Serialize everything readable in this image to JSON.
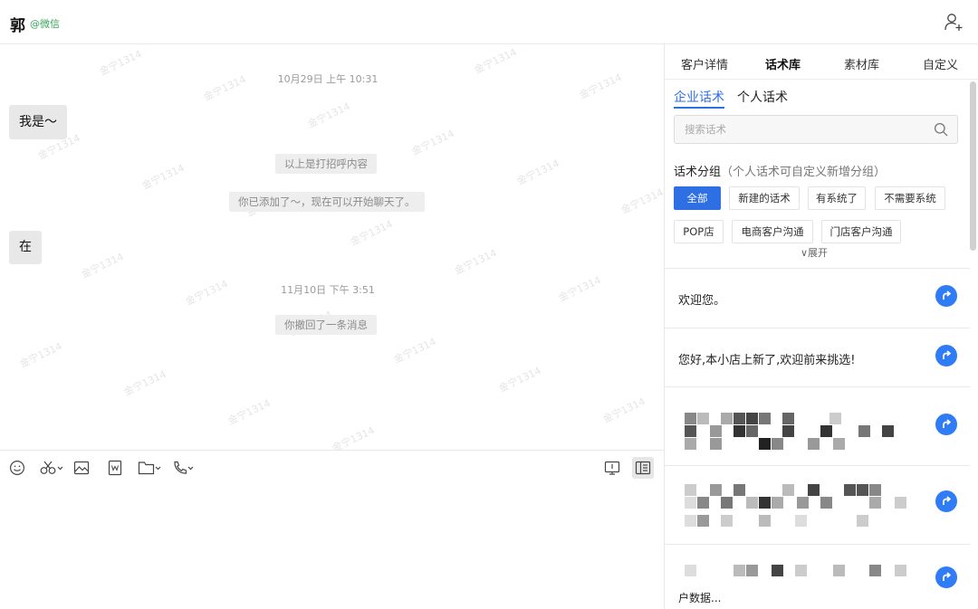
{
  "header": {
    "contact_name": "郭",
    "contact_source": "@微信"
  },
  "chat": {
    "watermark": "金宁1314",
    "messages": [
      {
        "kind": "time",
        "text": "10月29日 上午 10:31"
      },
      {
        "kind": "bubble",
        "text": "我是～"
      },
      {
        "kind": "system",
        "text": "以上是打招呼内容"
      },
      {
        "kind": "system",
        "text": "你已添加了～，现在可以开始聊天了。"
      },
      {
        "kind": "bubble",
        "text": "在"
      },
      {
        "kind": "time",
        "text": "11月10日 下午 3:51"
      },
      {
        "kind": "system",
        "text": "你撤回了一条消息"
      }
    ]
  },
  "toolbar": {
    "icons": [
      "emoji-icon",
      "scissors-icon",
      "image-icon",
      "word-file-icon",
      "folder-icon",
      "phone-icon",
      "screen-share-icon",
      "panel-toggle-icon"
    ]
  },
  "panel": {
    "tabs": [
      {
        "label": "客户详情",
        "active": false
      },
      {
        "label": "话术库",
        "active": true
      },
      {
        "label": "素材库",
        "active": false
      },
      {
        "label": "自定义",
        "active": false
      }
    ],
    "subtabs": [
      {
        "label": "企业话术",
        "active": true
      },
      {
        "label": "个人话术",
        "active": false
      }
    ],
    "search_placeholder": "搜索话术",
    "group_title": "话术分组",
    "group_hint": "（个人话术可自定义新增分组）",
    "chips": [
      {
        "label": "全部",
        "active": true
      },
      {
        "label": "新建的话术",
        "active": false
      },
      {
        "label": "有系统了",
        "active": false
      },
      {
        "label": "不需要系统",
        "active": false
      },
      {
        "label": "POP店",
        "active": false
      },
      {
        "label": "电商客户沟通",
        "active": false
      },
      {
        "label": "门店客户沟通",
        "active": false
      }
    ],
    "expand_label": "∨展开",
    "scripts": [
      {
        "text": "欢迎您。"
      },
      {
        "text": "您好,本小店上新了,欢迎前来挑选!"
      },
      {
        "text": ""
      },
      {
        "text": ""
      },
      {
        "text": "户数据..."
      }
    ]
  },
  "colors": {
    "accent": "#2f6fe4",
    "send_button": "#2f7cf6",
    "source_green": "#3aa55a"
  }
}
